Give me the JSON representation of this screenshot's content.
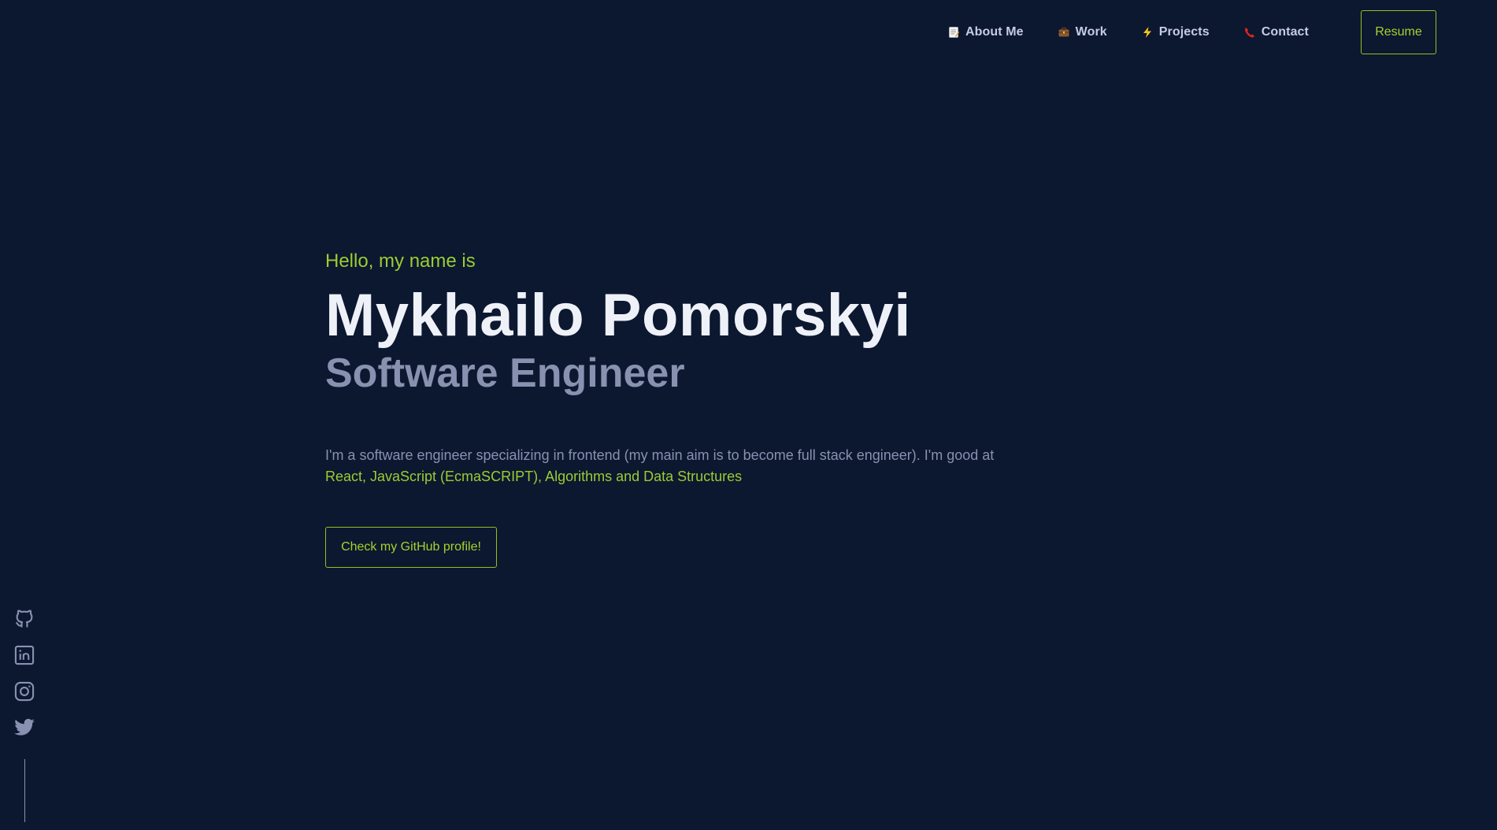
{
  "nav": {
    "items": [
      {
        "label": "About Me",
        "icon": "memo-icon"
      },
      {
        "label": "Work",
        "icon": "briefcase-icon"
      },
      {
        "label": "Projects",
        "icon": "lightning-icon"
      },
      {
        "label": "Contact",
        "icon": "telephone-icon"
      }
    ],
    "resume_label": "Resume"
  },
  "hero": {
    "greeting": "Hello, my name is",
    "name": "Mykhailo Pomorskyi",
    "role": "Software Engineer",
    "description_plain": "I'm a software engineer specializing in frontend (my main aim is to become full stack engineer). I'm good at",
    "description_skills": "React, JavaScript (EcmaSCRIPT), Algorithms and Data Structures",
    "github_button": "Check my GitHub profile!"
  },
  "social": {
    "items": [
      {
        "icon": "github-icon"
      },
      {
        "icon": "linkedin-icon"
      },
      {
        "icon": "instagram-icon"
      },
      {
        "icon": "twitter-icon"
      }
    ]
  },
  "colors": {
    "background": "#0c1730",
    "accent": "#9acd32",
    "text_primary": "#eef1f8",
    "text_secondary": "#8892b0"
  }
}
